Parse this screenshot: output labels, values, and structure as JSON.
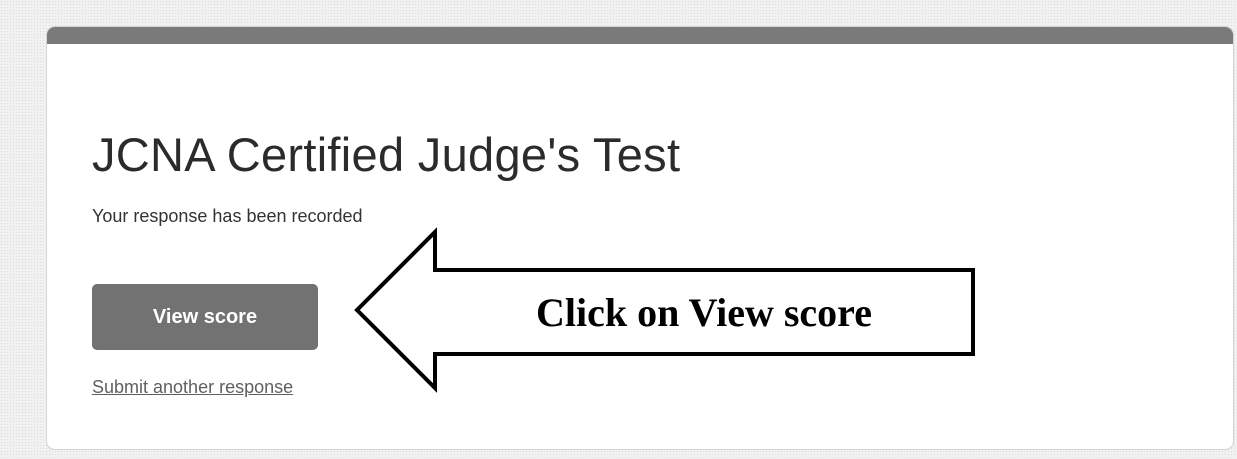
{
  "form": {
    "title": "JCNA Certified Judge's Test",
    "confirmation_message": "Your response has been recorded",
    "view_score_label": "View score",
    "submit_another_label": "Submit another response"
  },
  "annotation": {
    "callout_text": "Click on View score",
    "arrow_direction": "left"
  },
  "colors": {
    "top_bar": "#7a7a7a",
    "button_background": "#727272",
    "button_text": "#ffffff",
    "title_text": "#2b2b2b",
    "link_text": "#5f5f5f"
  }
}
